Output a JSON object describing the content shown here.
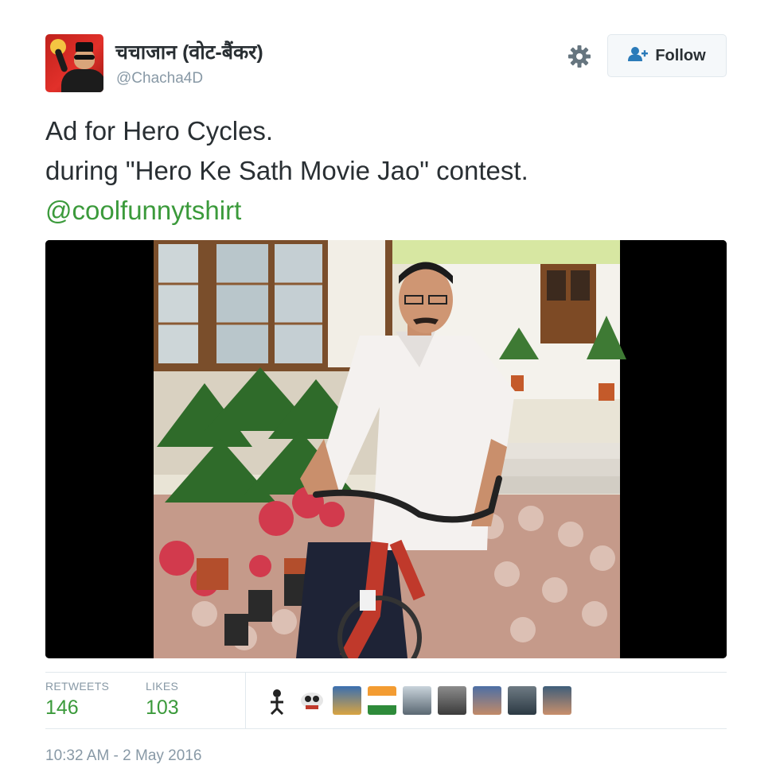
{
  "author": {
    "display_name": "चचाजान (वोट-बैंकर)",
    "username": "@Chacha4D",
    "avatar_icon": "profile-avatar"
  },
  "actions": {
    "settings_icon": "gear-icon",
    "follow_label": "Follow",
    "follow_icon": "add-user-icon"
  },
  "tweet": {
    "line1": "Ad for Hero Cycles.",
    "line2": "during \"Hero Ke Sath Movie Jao\" contest.",
    "mention": "@coolfunnytshirt"
  },
  "stats": {
    "retweets_label": "RETWEETS",
    "retweets_value": "146",
    "likes_label": "LIKES",
    "likes_value": "103"
  },
  "timestamp": "10:32 AM - 2 May 2016",
  "colors": {
    "link": "#3b9a3b",
    "muted": "#8899a6",
    "text": "#292f33",
    "border": "#e1e8ed"
  }
}
